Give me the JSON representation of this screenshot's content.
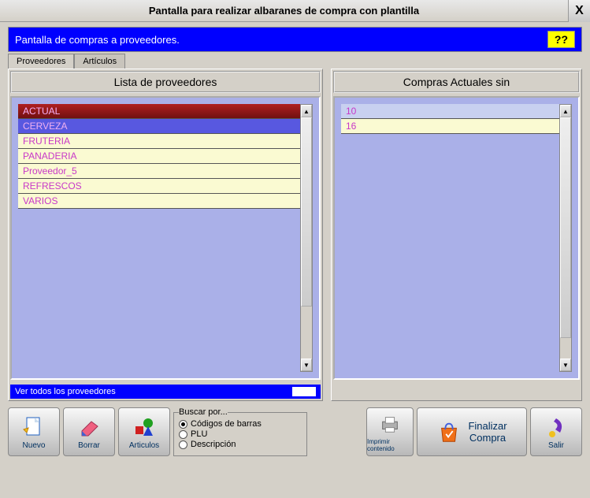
{
  "window": {
    "title": "Pantalla para realizar albaranes de compra con plantilla",
    "close": "X"
  },
  "header": {
    "subtitle": "Pantalla de compras a proveedores.",
    "help": "??"
  },
  "tabs": {
    "proveedores": "Proveedores",
    "articulos": "Artículos"
  },
  "panels": {
    "left_title": "Lista de proveedores",
    "right_title": "Compras Actuales sin"
  },
  "proveedores_list": [
    {
      "label": "ACTUAL",
      "state": "selected-red"
    },
    {
      "label": "CERVEZA",
      "state": "selected-blue"
    },
    {
      "label": "FRUTERIA",
      "state": ""
    },
    {
      "label": "PANADERIA",
      "state": ""
    },
    {
      "label": "Proveedor_5",
      "state": ""
    },
    {
      "label": "REFRESCOS",
      "state": ""
    },
    {
      "label": "VARIOS",
      "state": ""
    }
  ],
  "compras_list": [
    {
      "label": "10",
      "state": "highlight"
    },
    {
      "label": "16",
      "state": ""
    }
  ],
  "footer_link": "Ver todos los proveedores",
  "search": {
    "legend": "Buscar por...",
    "options": {
      "codigos": "Códigos de barras",
      "plu": "PLU",
      "descripcion": "Descripción"
    },
    "selected": "codigos"
  },
  "toolbar": {
    "nuevo": "Nuevo",
    "borrar": "Borrar",
    "articulos": "Articulos",
    "imprimir": "Imprimir contenido",
    "finalizar": "Finalizar Compra",
    "salir": "Salir"
  }
}
